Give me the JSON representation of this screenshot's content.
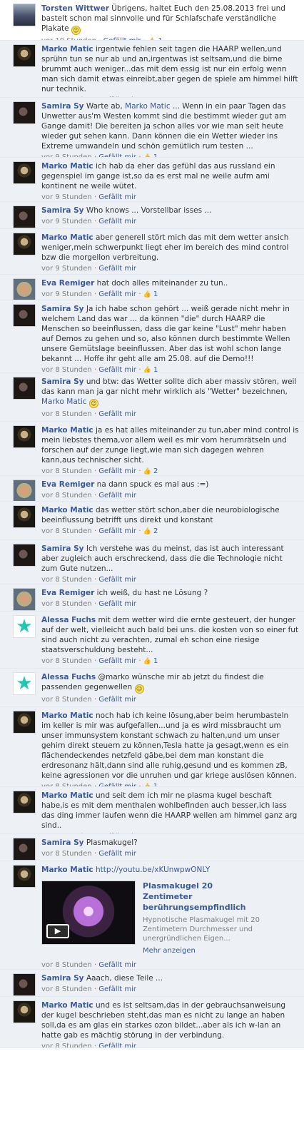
{
  "comments": [
    {
      "author": "Torsten Wittwer",
      "avatar": "torsten",
      "text": "Übrigens, haltet Euch den 25.08.2013 frei und bastelt schon mal sinnvolle und für Schlafschafe verständliche Plakate",
      "smiley": true,
      "time": "vor 10 Stunden",
      "like": "Gefällt mir",
      "count": "1",
      "first": true
    },
    {
      "author": "Marko Matic",
      "avatar": "marko",
      "text": "irgentwie fehlen seit tagen die HAARP wellen,und sprühn tun se nur ab und an,irgentwas ist seltsam,und die birne brummt auch weniger...das mit dem essig ist nur ein erfolg wenn man sich damit etwas einreibt,aber gegen de spiele am himmel hilft nur technik.",
      "time": "vor 9 Stunden",
      "like": "Gefällt mir"
    },
    {
      "author": "Samira Sy",
      "avatar": "samira",
      "text": "Warte ab, ",
      "mention": "Marko Matic",
      "text2": " ... Wenn in ein paar Tagen das Unwetter aus'm Westen kommt sind die bestimmt wieder gut am Gange damit! Die bereiten ja schon alles vor wie man seit heute wieder gut sehen kann. Dann können die ein Wetter wieder ins Extreme umwandeln und schön gemütlich rum testen ...",
      "time": "vor 9 Stunden",
      "like": "Gefällt mir",
      "count": "1"
    },
    {
      "author": "Marko Matic",
      "avatar": "marko",
      "text": "ich hab da eher das gefühl das aus russland ein gegenspiel im gange ist,so da es erst mal ne weile aufm ami kontinent ne weile wütet.",
      "time": "vor 9 Stunden",
      "like": "Gefällt mir"
    },
    {
      "author": "Samira Sy",
      "avatar": "samira",
      "text": "Who knows ... Vorstellbar isses ...",
      "time": "vor 9 Stunden",
      "like": "Gefällt mir"
    },
    {
      "author": "Marko Matic",
      "avatar": "marko",
      "text": "aber generell stört mich das mit dem wetter ansich weniger,mein schwerpunkt liegt eher im bereich des mind control bzw die morgellon verbreitung.",
      "time": "vor 9 Stunden",
      "like": "Gefällt mir"
    },
    {
      "author": "Eva Remiger",
      "avatar": "eva",
      "text": "hat doch alles miteinander zu tun..",
      "time": "vor 9 Stunden",
      "like": "Gefällt mir",
      "count": "1"
    },
    {
      "author": "Samira Sy",
      "avatar": "samira",
      "text": "Ja ich habe schon gehört ... weiß gerade nicht mehr in welchem Land das war ... da können \"die\" durch HAARP die Menschen so beeinflussen, dass die gar keine \"Lust\" mehr haben auf Demos zu gehen und so, also können durch bestimmte Wellen unsere Gemütslage beeinflussen. Aber das ist wohl schon lange bekannt ... Hoffe ihr geht alle am 25.08. auf die Demo!!!",
      "time": "vor 8 Stunden",
      "like": "Gefällt mir",
      "count": "1"
    },
    {
      "author": "Samira Sy",
      "avatar": "samira",
      "text": "und btw: das Wetter sollte dich aber massiv stören, weil das kann man ja gar nicht mehr wirklich als \"Wetter\" bezeichnen, ",
      "mention": "Marko Matic",
      "smiley": true,
      "time": "vor 8 Stunden",
      "like": "Gefällt mir"
    },
    {
      "author": "Marko Matic",
      "avatar": "marko",
      "text": "ja es hat alles miteinander zu tun,aber mind control is mein liebstes thema,vor allem weil es mir vom herumrätseln und forschen auf der zunge liegt,wie man sich dagegen wehren kann,aus technischer sicht.",
      "time": "vor 8 Stunden",
      "like": "Gefällt mir",
      "count": "2"
    },
    {
      "author": "Eva Remiger",
      "avatar": "eva",
      "text": "na dann spuck es mal aus :=)",
      "time": "vor 8 Stunden",
      "like": "Gefällt mir"
    },
    {
      "author": "Marko Matic",
      "avatar": "marko",
      "text": "das wetter stört schon,aber die neurobiologische beeinflussung betrifft uns direkt und konstant",
      "time": "vor 8 Stunden",
      "like": "Gefällt mir",
      "count": "2"
    },
    {
      "author": "Samira Sy",
      "avatar": "samira",
      "text": "Ich verstehe was du meinst, das ist auch interessant aber zugleich auch erschreckend, dass die die Technologie nicht zum Gute nutzen...",
      "time": "vor 8 Stunden",
      "like": "Gefällt mir"
    },
    {
      "author": "Eva Remiger",
      "avatar": "eva",
      "text": "ich weiß, du hast ne Lösung ?",
      "time": "vor 8 Stunden",
      "like": "Gefällt mir"
    },
    {
      "author": "Alessa Fuchs",
      "avatar": "alessa",
      "text": "mit dem wetter wird die ernte gesteuert, der hunger auf der welt, vielleicht auch bald bei uns. die kosten von so einer fut sind auch nicht zu verachten, zumal eh schon eine riesige staatsverschuldung besteht...",
      "time": "vor 8 Stunden",
      "like": "Gefällt mir",
      "count": "1"
    },
    {
      "author": "Alessa Fuchs",
      "avatar": "alessa",
      "text": "@marko wünsche mir ab jetzt du findest die passenden gegenwellen",
      "smiley": true,
      "time": "vor 8 Stunden",
      "like": "Gefällt mir"
    },
    {
      "author": "Marko Matic",
      "avatar": "marko",
      "text": "noch hab ich keine lösung,aber beim herumbasteln im keller is mir was aufgefallen...und ja es wird missbraucht um unser immunsystem konstant schwach zu halten,und um unser gehirn direkt steuern zu können,Tesla hatte ja gesagt,wenn es ein flächendeckendes netzfeld gäbe,bei dem man konstant die erdresonanz hält,dann sind alle ruhig,gesund und es kommen zB, keine agressionen vor die unruhen und gar kriege auslösen können.",
      "time": "vor 8 Stunden",
      "like": "Gefällt mir",
      "count": "1"
    },
    {
      "author": "Marko Matic",
      "avatar": "marko",
      "text": "und seit dem ich mir ne plasma kugel beschaft habe,is es mit dem menthalen wohlbefinden auch besser,ich lass das ding immer laufen wenn die HAARP wellen am himmel ganz arg sind..",
      "time": "vor 8 Stunden",
      "like": "Gefällt mir"
    },
    {
      "author": "Samira Sy",
      "avatar": "samira",
      "text": "Plasmakugel?",
      "time": "vor 8 Stunden",
      "like": "Gefällt mir"
    },
    {
      "author": "Marko Matic",
      "avatar": "marko",
      "link": "http://youtu.be/xKUnwpwONLY",
      "video": {
        "title": "Plasmakugel 20 Zentimeter berührungsempfindlich",
        "desc": "Hypnotische Plasmakugel mit 20 Zentimetern Durchmesser und unergründlichen Eigen...",
        "more": "Mehr anzeigen"
      },
      "time": "vor 8 Stunden",
      "like": "Gefällt mir"
    },
    {
      "author": "Samira Sy",
      "avatar": "samira",
      "text": "Aaach, diese Teile ...",
      "time": "vor 8 Stunden",
      "like": "Gefällt mir"
    },
    {
      "author": "Marko Matic",
      "avatar": "marko",
      "text": "und es ist seltsam,das in der gebrauchsanweisung der kugel beschrieben steht,das man es nicht zu lange an haben soll,da es am glas ein starkes ozon bildet...aber als ich w-lan an hatte gab es mächtig störung in der verbindung.",
      "time": "vor 8 Stunden",
      "like": "Gefällt mir"
    }
  ],
  "separator": " · ",
  "thumb_icon": "thumbs-up-icon",
  "smiley_icon": "smiley-icon",
  "play_icon": "play-icon",
  "accent_color": "#3b5998"
}
